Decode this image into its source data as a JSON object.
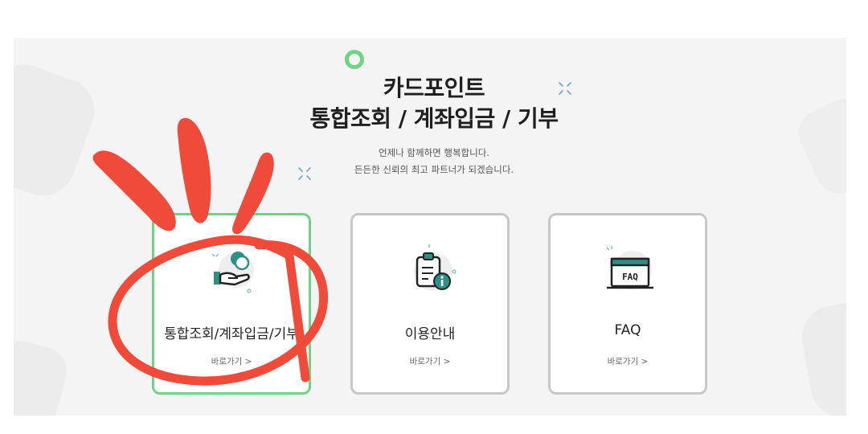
{
  "hero": {
    "title_line1": "카드포인트",
    "title_line2": "통합조회 / 계좌입금 / 기부",
    "subtitle_line1": "언제나 함께하면 행복합니다.",
    "subtitle_line2": "든든한 신뢰의 최고 파트너가 되겠습니다."
  },
  "cards": [
    {
      "label": "통합조회/계좌입금/기부",
      "link": "바로가기 >",
      "icon": "hand-coin-icon",
      "active": true
    },
    {
      "label": "이용안내",
      "link": "바로가기 >",
      "icon": "clipboard-info-icon",
      "active": false
    },
    {
      "label": "FAQ",
      "link": "바로가기 >",
      "icon": "faq-window-icon",
      "active": false
    }
  ],
  "colors": {
    "accent_green": "#6fd386",
    "icon_teal": "#2f8f86",
    "card_border": "#c8c8c8",
    "annotation_red": "#f04a3a"
  }
}
